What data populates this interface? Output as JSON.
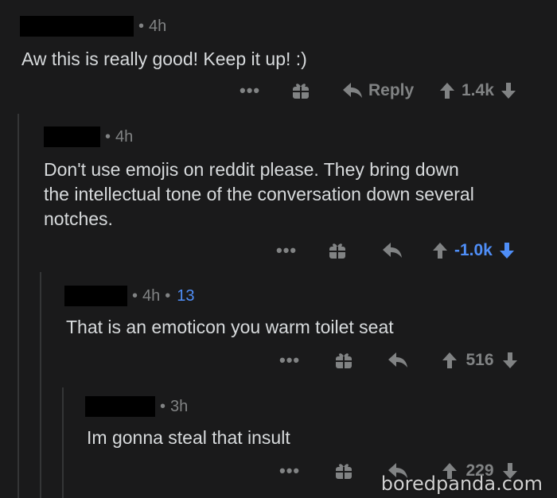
{
  "comments": [
    {
      "time": "4h",
      "body": "Aw this is really good! Keep it up! :)",
      "reply_label": "Reply",
      "score": "1.4k",
      "more": "•••"
    },
    {
      "time": "4h",
      "body": "Don't use emojis on reddit please. They bring down\nthe intellectual tone of the conversation down several\nnotches.",
      "score": "-1.0k",
      "more": "•••"
    },
    {
      "time": "4h",
      "score_inline": "13",
      "body": "That is an emoticon you warm toilet seat",
      "score": "516",
      "more": "•••"
    },
    {
      "time": "3h",
      "body": "Im gonna steal that insult",
      "score": "229",
      "more": "•••"
    }
  ],
  "watermark": "boredpanda.com",
  "colors": {
    "background": "#1a1a1b",
    "text": "#d7dadc",
    "muted": "#818384",
    "downvote_active": "#4f8ef7",
    "redaction": "#000000"
  },
  "icons": {
    "gift": "gift-icon",
    "reply": "reply-arrow-icon",
    "upvote": "upvote-arrow-icon",
    "downvote": "downvote-arrow-icon",
    "more": "more-options-icon"
  }
}
